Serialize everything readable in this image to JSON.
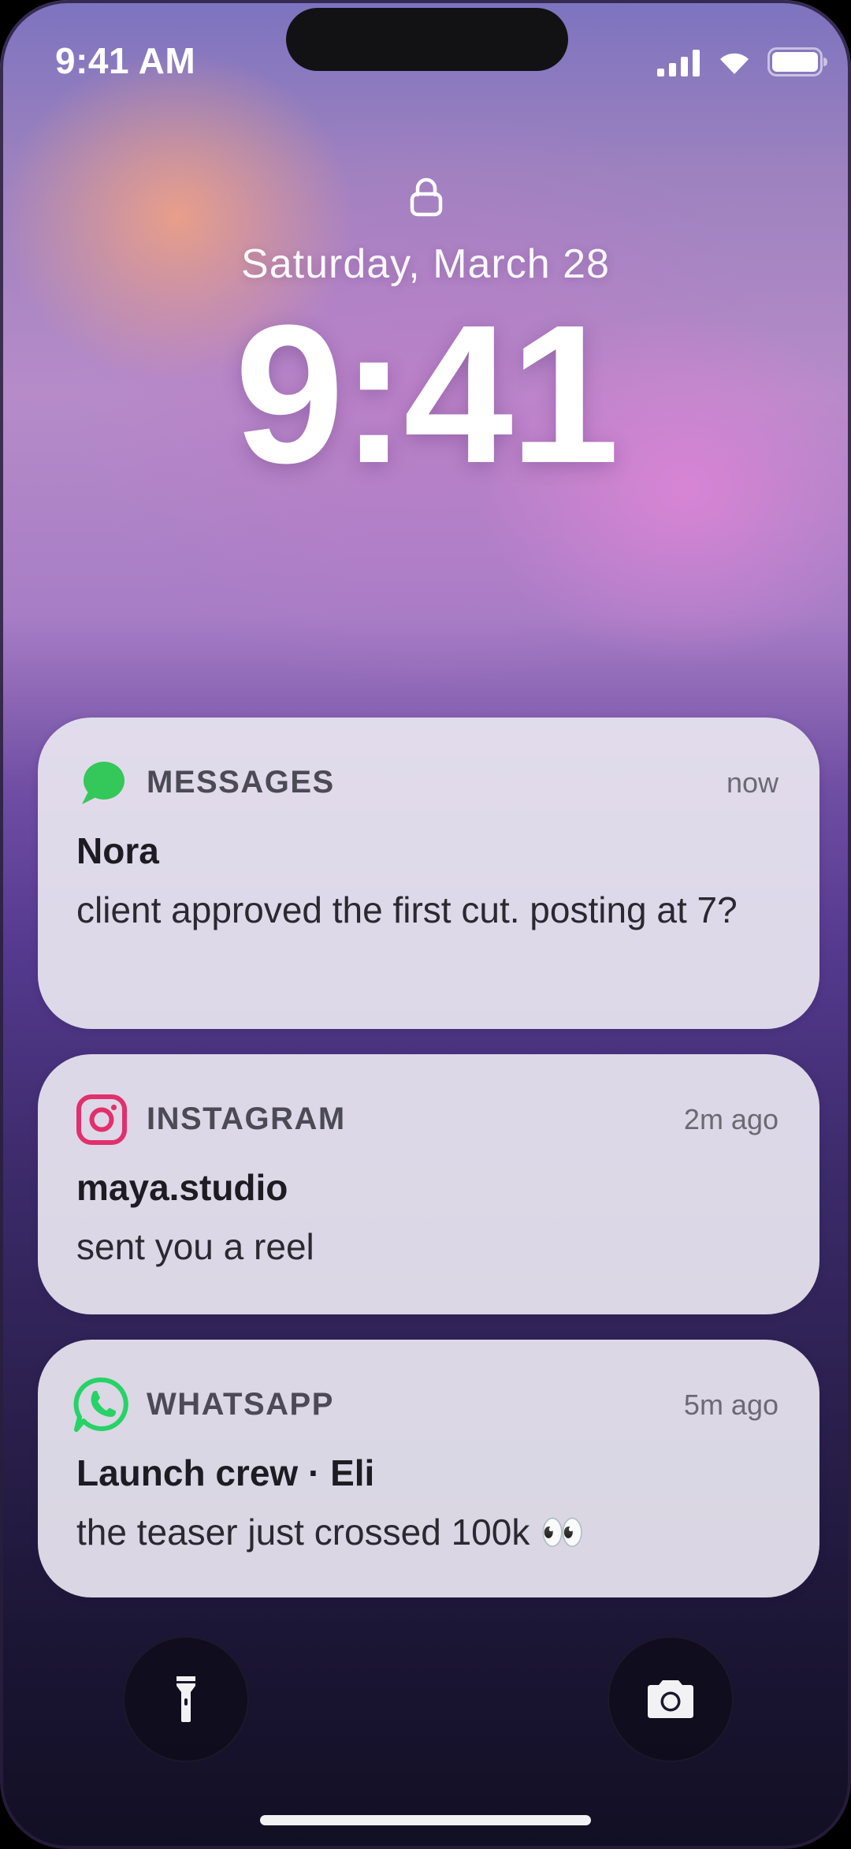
{
  "status_bar": {
    "time": "9:41 AM"
  },
  "lock_screen": {
    "date": "Saturday, March 28",
    "clock": "9:41"
  },
  "notifications": [
    {
      "app": "MESSAGES",
      "time": "now",
      "title": "Nora",
      "body": "client approved the first cut. posting at 7?",
      "icon": "messages-icon",
      "accent": "#34c759"
    },
    {
      "app": "INSTAGRAM",
      "time": "2m ago",
      "title": "maya.studio",
      "body": "sent you a reel",
      "icon": "instagram-icon",
      "accent": "#e1306c"
    },
    {
      "app": "WHATSAPP",
      "time": "5m ago",
      "title": "Launch crew · Eli",
      "body": "the teaser just crossed 100k 👀",
      "icon": "whatsapp-icon",
      "accent": "#25d366"
    }
  ],
  "quick_actions": [
    {
      "icon": "flashlight-icon"
    },
    {
      "icon": "camera-icon"
    }
  ]
}
